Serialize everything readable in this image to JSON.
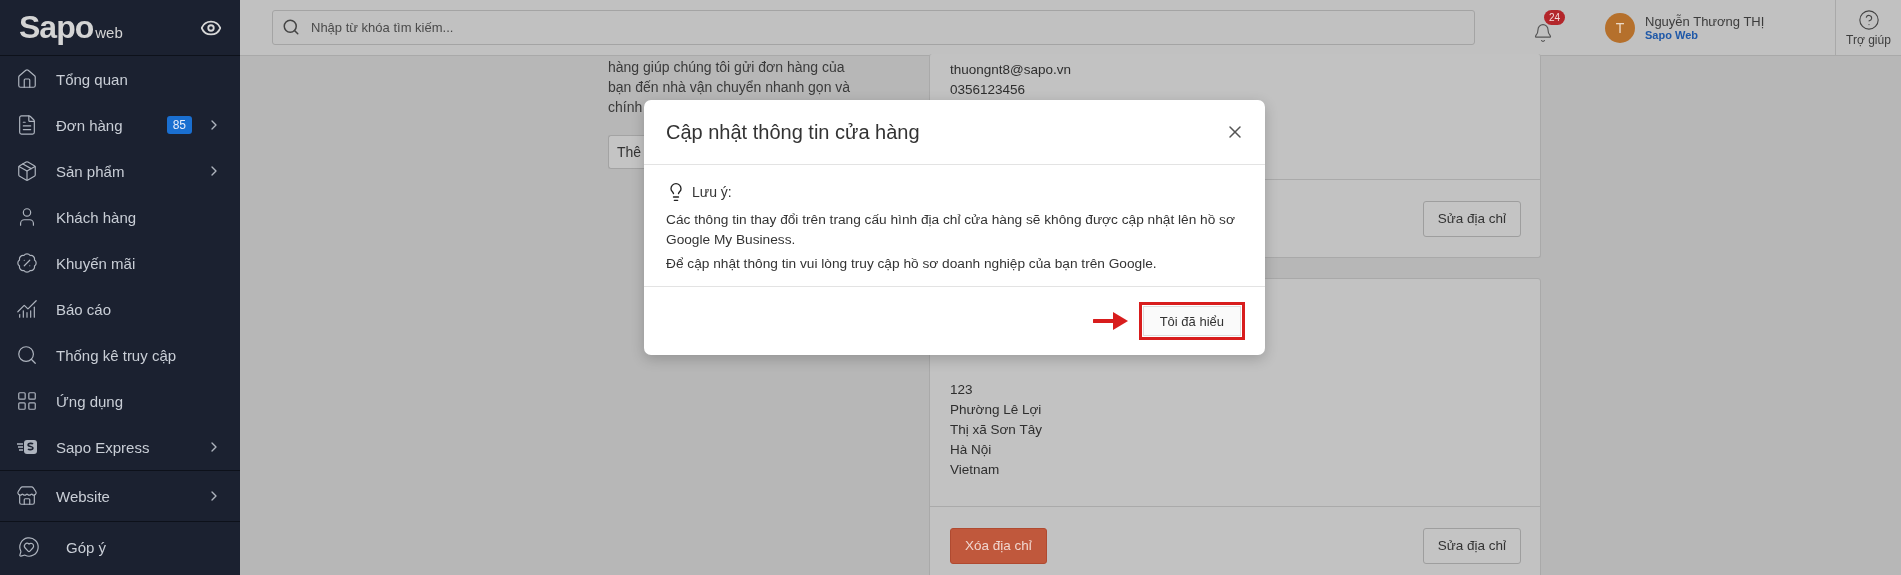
{
  "sidebar": {
    "logo": {
      "name": "Sapo",
      "suffix": "web"
    },
    "sections": [
      {
        "items": [
          {
            "label": "Tổng quan",
            "has_submenu": false
          },
          {
            "label": "Đơn hàng",
            "badge": "85",
            "has_submenu": true
          },
          {
            "label": "Sản phẩm",
            "has_submenu": true
          },
          {
            "label": "Khách hàng",
            "has_submenu": false
          },
          {
            "label": "Khuyến mãi",
            "has_submenu": false
          },
          {
            "label": "Báo cáo",
            "has_submenu": false
          },
          {
            "label": "Thống kê truy cập",
            "has_submenu": false
          },
          {
            "label": "Ứng dụng",
            "has_submenu": false
          },
          {
            "label": "Sapo Express",
            "has_submenu": true
          }
        ]
      },
      {
        "items": [
          {
            "label": "Website",
            "has_submenu": true
          }
        ]
      },
      {
        "items": [
          {
            "label": "Góp ý",
            "has_submenu": false
          }
        ]
      }
    ]
  },
  "header": {
    "search": {
      "placeholder": "Nhập từ khóa tìm kiếm..."
    },
    "notifications": "24",
    "user": {
      "initial": "T",
      "name": "Nguyễn Thương THỊ",
      "store": "Sapo Web"
    },
    "help": "Trợ giúp"
  },
  "left_panel": {
    "description_lines": [
      "hàng giúp chúng tôi gửi đơn hàng của",
      "bạn đến nhà vận chuyển nhanh gọn và",
      "chính"
    ],
    "button": "Thê"
  },
  "address_cards": [
    {
      "lines": [
        "thuongnt8@sapo.vn",
        "0356123456"
      ],
      "buttons": [
        {
          "label": "Sửa địa chỉ",
          "kind": "secondary"
        }
      ]
    },
    {
      "lines": [
        "123",
        "Phường Lê Lợi",
        "Thị xã Sơn Tây",
        "Hà Nội",
        "Vietnam"
      ],
      "buttons": [
        {
          "label": "Xóa địa chỉ",
          "kind": "danger"
        },
        {
          "label": "Sửa địa chỉ",
          "kind": "secondary"
        }
      ]
    }
  ],
  "modal": {
    "title": "Cập nhật thông tin cửa hàng",
    "note_label": "Lưu ý:",
    "paragraphs": [
      "Các thông tin thay đổi trên trang cấu hình địa chỉ cửa hàng sẽ không được cập nhật lên hồ sơ Google My Business.",
      "Để cập nhật thông tin vui lòng truy cập hồ sơ doanh nghiệp của bạn trên Google."
    ],
    "confirm_button": {
      "label": "Tôi đã hiểu",
      "highlighted": true
    }
  }
}
